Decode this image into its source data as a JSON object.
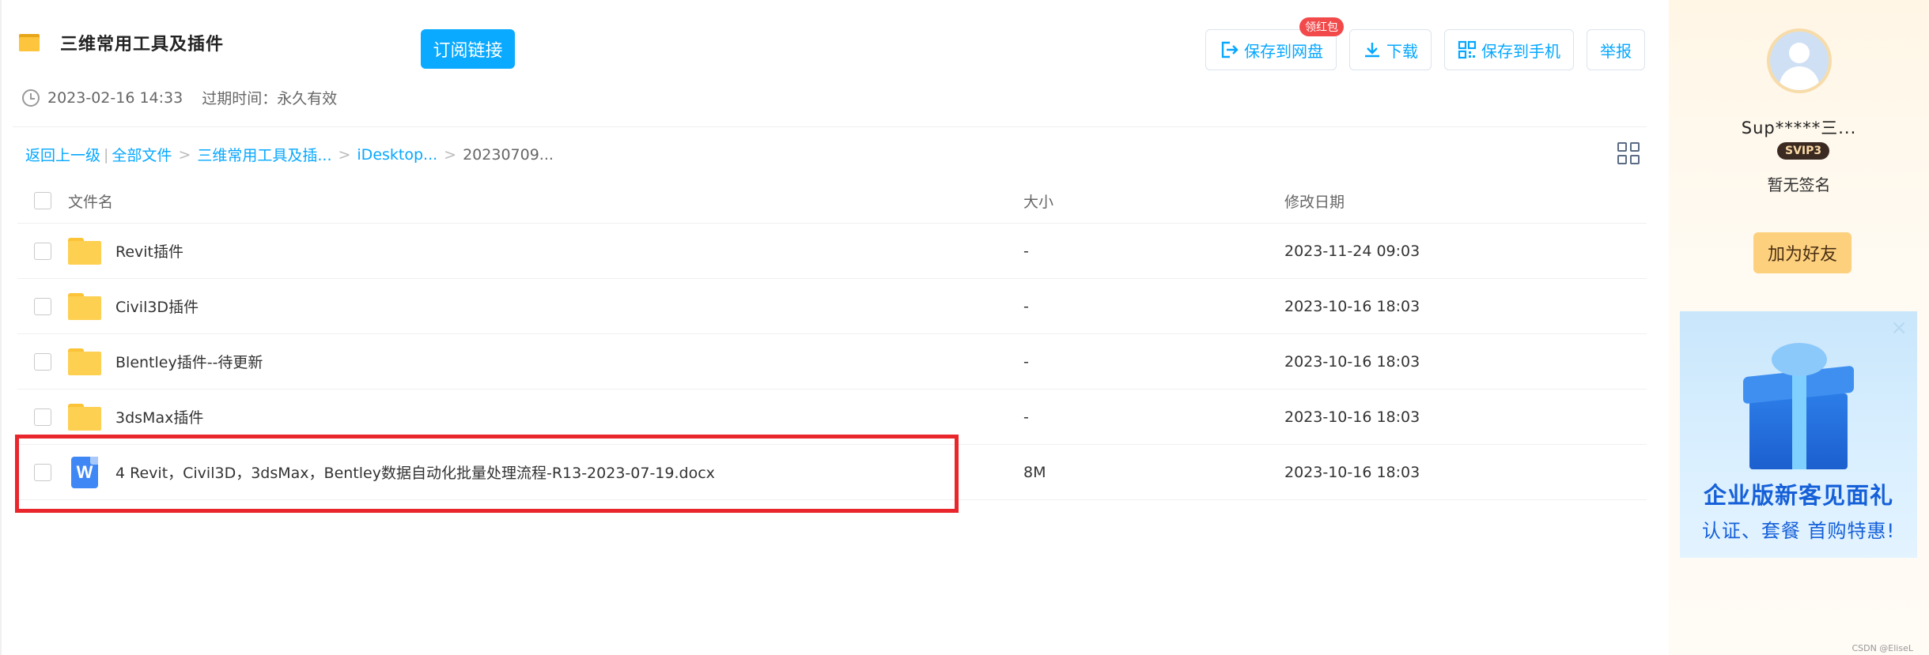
{
  "share": {
    "title": "三维常用工具及插件",
    "subscribe_label": "订阅链接",
    "created": "2023-02-16 14:33",
    "expire_label": "过期时间：永久有效"
  },
  "toolbar": {
    "save_to_cloud": "保存到网盘",
    "red_packet_badge": "领红包",
    "download": "下载",
    "save_to_phone": "保存到手机",
    "report": "举报"
  },
  "breadcrumb": {
    "back": "返回上一级",
    "separator": "|",
    "items": [
      "全部文件",
      "三维常用工具及插...",
      "iDesktop..."
    ],
    "current": "20230709...",
    "arrow": ">"
  },
  "table": {
    "headers": {
      "name": "文件名",
      "size": "大小",
      "date": "修改日期"
    },
    "rows": [
      {
        "type": "folder",
        "name": "Revit插件",
        "size": "-",
        "date": "2023-11-24 09:03"
      },
      {
        "type": "folder",
        "name": "Civil3D插件",
        "size": "-",
        "date": "2023-10-16 18:03"
      },
      {
        "type": "folder",
        "name": "Blentley插件--待更新",
        "size": "-",
        "date": "2023-10-16 18:03"
      },
      {
        "type": "folder",
        "name": "3dsMax插件",
        "size": "-",
        "date": "2023-10-16 18:03"
      },
      {
        "type": "word",
        "icon_letter": "W",
        "name": "4 Revit，Civil3D，3dsMax，Bentley数据自动化批量处理流程-R13-2023-07-19.docx",
        "size": "8M",
        "date": "2023-10-16 18:03"
      }
    ]
  },
  "sidebar": {
    "username": "Sup*****三...",
    "vip": "SVIP3",
    "signature": "暂无签名",
    "add_friend": "加为好友",
    "ad_title": "企业版新客见面礼",
    "ad_sub": "认证、套餐 首购特惠!",
    "ad_close": "×"
  },
  "watermark": "CSDN @EliseL",
  "colors": {
    "accent": "#06a7ff",
    "highlight": "#e8262b",
    "folder": "#fdd051"
  }
}
